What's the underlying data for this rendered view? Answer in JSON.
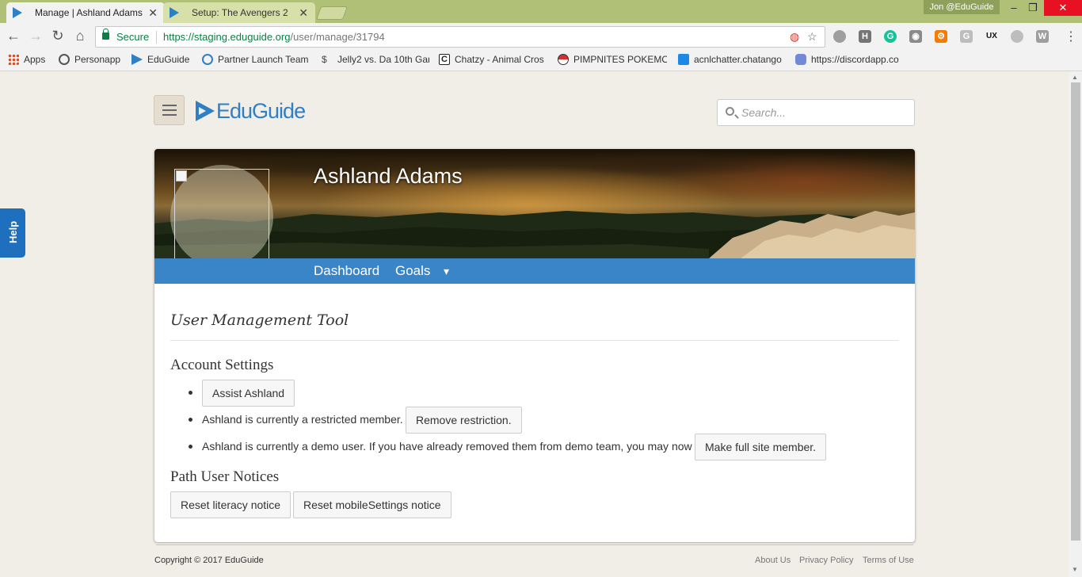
{
  "browser": {
    "tabs": [
      {
        "title": "Manage | Ashland Adams",
        "active": true
      },
      {
        "title": "Setup: The Avengers 2",
        "active": false
      }
    ],
    "profile_label": "Jon @EduGuide",
    "secure_label": "Secure",
    "url_host": "https://staging.eduguide.org",
    "url_path": "/user/manage/31794",
    "bookmarks": [
      {
        "label": "Apps",
        "icon": "apps-grid-icon",
        "color": "#e64a19"
      },
      {
        "label": "Personapp",
        "icon": "personapp-icon",
        "color": "#555555"
      },
      {
        "label": "EduGuide",
        "icon": "eduguide-icon",
        "color": "#2f7fc5"
      },
      {
        "label": "Partner Launch Team",
        "icon": "partner-icon",
        "color": "#2f7fc5"
      },
      {
        "label": "Jelly2 vs. Da 10th Gar",
        "icon": "jelly-icon",
        "color": "#444444"
      },
      {
        "label": "Chatzy - Animal Cros",
        "icon": "chatzy-icon",
        "color": "#222222"
      },
      {
        "label": "PIMPNITES POKEMO",
        "icon": "pokeball-icon",
        "color": "#d32f2f"
      },
      {
        "label": "acnlchatter.chatango",
        "icon": "chatango-icon",
        "color": "#1e88e5"
      },
      {
        "label": "https://discordapp.co",
        "icon": "discord-icon",
        "color": "#7289da"
      }
    ]
  },
  "header": {
    "logo_text": "EduGuide",
    "search_placeholder": "Search..."
  },
  "help": {
    "label": "Help"
  },
  "profile": {
    "name": "Ashland Adams",
    "nav": [
      {
        "label": "Dashboard"
      },
      {
        "label": "Goals"
      },
      {
        "label": "▾"
      }
    ]
  },
  "main": {
    "title": "User Management Tool",
    "account_settings": {
      "heading": "Account Settings",
      "assist_button": "Assist Ashland",
      "restricted_text": "Ashland is currently a restricted member.",
      "remove_restriction_button": "Remove restriction.",
      "demo_text": "Ashland is currently a demo user. If you have already removed them from demo team, you may now",
      "full_member_button": "Make full site member."
    },
    "path_notices": {
      "heading": "Path User Notices",
      "reset_literacy_button": "Reset literacy notice",
      "reset_mobile_button": "Reset mobileSettings notice"
    }
  },
  "footer": {
    "copyright": "Copyright © 2017 EduGuide",
    "links": [
      {
        "label": "About Us"
      },
      {
        "label": "Privacy Policy"
      },
      {
        "label": "Terms of Use"
      }
    ]
  },
  "colors": {
    "brand_blue": "#2f7fc5",
    "nav_blue": "#3a84c8",
    "help_blue": "#1f6fbf",
    "page_bg": "#f1ede7",
    "chrome_green": "#b0c076"
  }
}
